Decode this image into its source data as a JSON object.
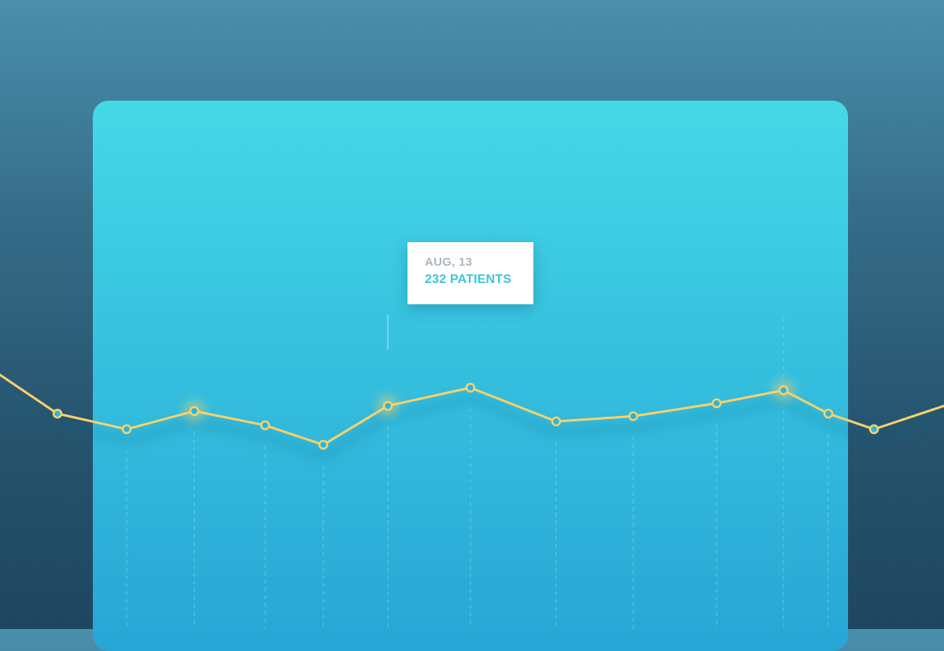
{
  "colors": {
    "line": "#f9d16a",
    "point_fill": "#2fb4d8",
    "guide": "#ffffff",
    "tooltip_date": "#a9b7bf",
    "tooltip_value": "#3cc6dc"
  },
  "tooltip": {
    "date": "AUG, 13",
    "value": "232 PATIENTS"
  },
  "chart_data": {
    "type": "line",
    "grid": false,
    "legend": "none",
    "highlighted_index": 6,
    "series": [
      {
        "values": [
          256,
          222,
          210,
          224,
          213,
          198,
          228,
          242,
          216,
          220,
          230,
          240,
          222,
          210,
          230
        ]
      }
    ]
  }
}
